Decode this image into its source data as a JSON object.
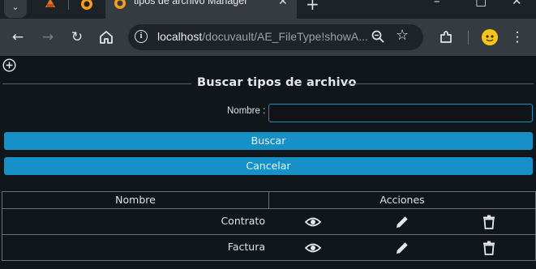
{
  "browser": {
    "active_tab_title": "tipos de archivo Manager",
    "url_host": "localhost",
    "url_path": "/docuvault/AE_FileType!showA..."
  },
  "page": {
    "legend_title": "Buscar tipos de archivo",
    "search_form": {
      "name_label": "Nombre :",
      "name_value": ""
    },
    "buttons": {
      "search": "Buscar",
      "cancel": "Cancelar"
    },
    "table": {
      "headers": [
        "Nombre",
        "Acciones"
      ],
      "rows": [
        {
          "name": "Contrato",
          "actions": [
            "view-icon",
            "edit-icon",
            "delete-icon"
          ]
        },
        {
          "name": "Factura",
          "actions": [
            "view-icon",
            "edit-icon",
            "delete-icon"
          ]
        }
      ]
    }
  },
  "colors": {
    "accent": "#1690c7",
    "background": "#11161b"
  }
}
